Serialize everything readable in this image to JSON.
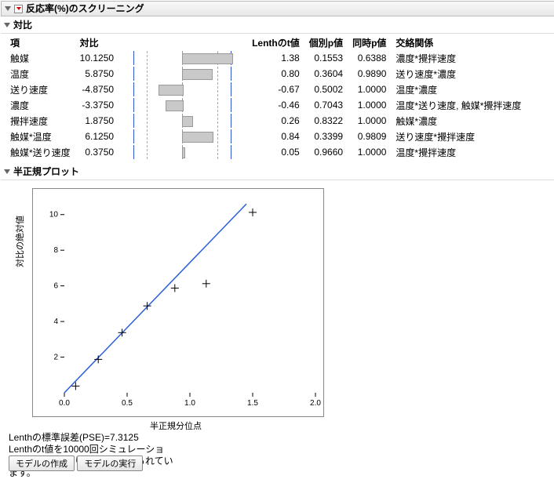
{
  "header": {
    "title": "反応率(%)のスクリーニング"
  },
  "section_contrast": {
    "title": "対比",
    "columns": [
      "項",
      "対比",
      "",
      "Lenthのt値",
      "個別p値",
      "同時p値",
      "交絡関係"
    ],
    "rows": [
      {
        "term": "触媒",
        "contrast": "10.1250",
        "t": "1.38",
        "p_ind": "0.1553",
        "p_sim": "0.6388",
        "alias": "濃度*攪拌速度"
      },
      {
        "term": "温度",
        "contrast": "5.8750",
        "t": "0.80",
        "p_ind": "0.3604",
        "p_sim": "0.9890",
        "alias": "送り速度*濃度"
      },
      {
        "term": "送り速度",
        "contrast": "-4.8750",
        "t": "-0.67",
        "p_ind": "0.5002",
        "p_sim": "1.0000",
        "alias": "温度*濃度"
      },
      {
        "term": "濃度",
        "contrast": "-3.3750",
        "t": "-0.46",
        "p_ind": "0.7043",
        "p_sim": "1.0000",
        "alias": "温度*送り速度, 触媒*攪拌速度"
      },
      {
        "term": "攪拌速度",
        "contrast": "1.8750",
        "t": "0.26",
        "p_ind": "0.8322",
        "p_sim": "1.0000",
        "alias": "触媒*濃度"
      },
      {
        "term": "触媒*温度",
        "contrast": "6.1250",
        "t": "0.84",
        "p_ind": "0.3399",
        "p_sim": "0.9809",
        "alias": "送り速度*攪拌速度"
      },
      {
        "term": "触媒*送り速度",
        "contrast": "0.3750",
        "t": "0.05",
        "p_ind": "0.9660",
        "p_sim": "1.0000",
        "alias": "温度*攪拌速度"
      }
    ]
  },
  "section_halfnorm": {
    "title": "半正規プロット"
  },
  "chart_data": {
    "type": "scatter",
    "title": "",
    "xlabel": "半正規分位点",
    "ylabel": "対比の絶対値",
    "xlim": [
      0.0,
      2.0
    ],
    "ylim": [
      0,
      11
    ],
    "xticks": [
      0.0,
      0.5,
      1.0,
      1.5,
      2.0
    ],
    "yticks": [
      2,
      4,
      6,
      8,
      10
    ],
    "points": [
      {
        "x": 0.09,
        "y": 0.375
      },
      {
        "x": 0.27,
        "y": 1.875
      },
      {
        "x": 0.46,
        "y": 3.375
      },
      {
        "x": 0.66,
        "y": 4.875
      },
      {
        "x": 0.88,
        "y": 5.875
      },
      {
        "x": 1.13,
        "y": 6.125
      },
      {
        "x": 1.5,
        "y": 10.125
      }
    ],
    "fit_line": {
      "x0": 0.0,
      "y0": 0.0,
      "x1": 1.45,
      "y1": 10.6
    }
  },
  "notes": {
    "pse": "Lenthの標準誤差(PSE)=7.3125",
    "sim": "Lenthのt値を10000回シミュレーションすることにより、p値は求められています。"
  },
  "buttons": {
    "make_model": "モデルの作成",
    "run_model": "モデルの実行"
  }
}
